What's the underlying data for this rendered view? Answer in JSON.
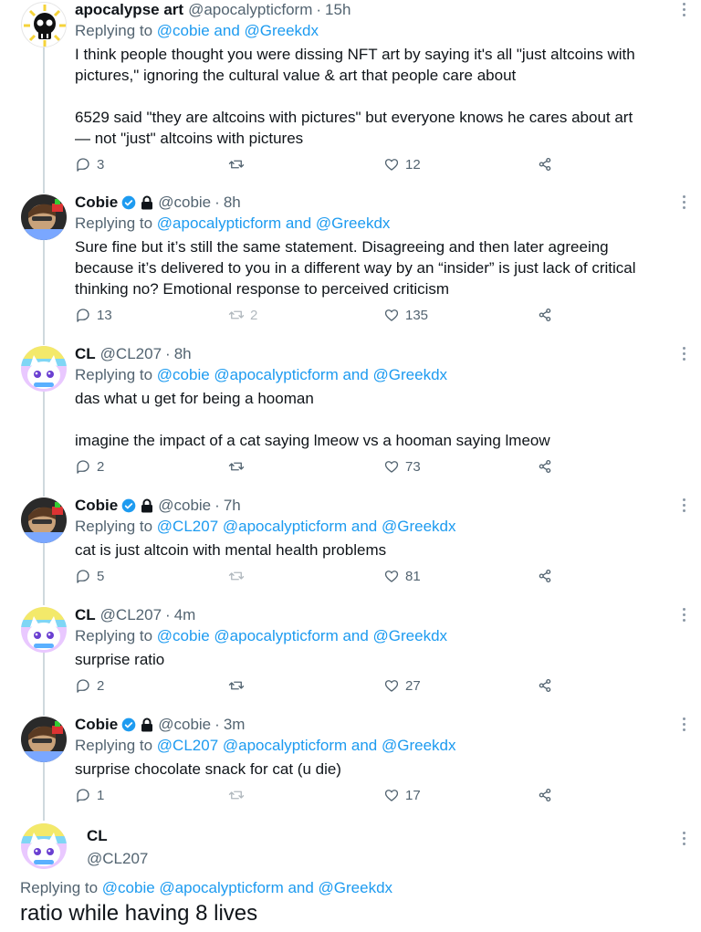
{
  "tweets": [
    {
      "name": "apocalypse art",
      "handle": "@apocalypticform",
      "time": "15h",
      "verified": false,
      "locked": false,
      "replying_label": "Replying to",
      "replying_links": "@cobie and @Greekdx",
      "text": "I think people thought you were dissing NFT art by saying it's all \"just altcoins with\npictures,\" ignoring the cultural value & art that people care about\n\n6529 said \"they are altcoins with pictures\" but everyone knows he cares about art\n— not \"just\" altcoins with pictures",
      "replies": "3",
      "retweets": "",
      "likes": "12"
    },
    {
      "name": "Cobie",
      "handle": "@cobie",
      "time": "8h",
      "verified": true,
      "locked": true,
      "replying_label": "Replying to",
      "replying_links": "@apocalypticform and @Greekdx",
      "text": "Sure fine but it’s still the same statement. Disagreeing and then later agreeing\nbecause it’s delivered to you in a different way by an “insider” is just lack of critical\nthinking no? Emotional response to perceived criticism",
      "replies": "13",
      "retweets": "2",
      "likes": "135"
    },
    {
      "name": "CL",
      "handle": "@CL207",
      "time": "8h",
      "verified": false,
      "locked": false,
      "replying_label": "Replying to",
      "replying_links": "@cobie @apocalypticform and @Greekdx",
      "text": "das what u get for being a hooman\n\nimagine the impact of a cat saying lmeow vs a hooman saying lmeow",
      "replies": "2",
      "retweets": "",
      "likes": "73"
    },
    {
      "name": "Cobie",
      "handle": "@cobie",
      "time": "7h",
      "verified": true,
      "locked": true,
      "replying_label": "Replying to",
      "replying_links": "@CL207 @apocalypticform and @Greekdx",
      "text": "cat is just altcoin with mental health problems",
      "replies": "5",
      "retweets": "",
      "likes": "81"
    },
    {
      "name": "CL",
      "handle": "@CL207",
      "time": "4m",
      "verified": false,
      "locked": false,
      "replying_label": "Replying to",
      "replying_links": "@cobie @apocalypticform and @Greekdx",
      "text": "surprise ratio",
      "replies": "2",
      "retweets": "",
      "likes": "27"
    },
    {
      "name": "Cobie",
      "handle": "@cobie",
      "time": "3m",
      "verified": true,
      "locked": true,
      "replying_label": "Replying to",
      "replying_links": "@CL207 @apocalypticform and @Greekdx",
      "text": "surprise chocolate snack for cat (u die)",
      "replies": "1",
      "retweets": "",
      "likes": "17"
    }
  ],
  "focused": {
    "name": "CL",
    "handle": "@CL207",
    "replying_label": "Replying to",
    "replying_links": "@cobie @apocalypticform and @Greekdx",
    "text": "ratio while having 8 lives"
  },
  "icons": {
    "reply": "reply-icon",
    "retweet": "retweet-icon",
    "like": "heart-icon",
    "share": "share-icon",
    "more": "more-icon",
    "verified": "verified-badge-icon",
    "locked": "lock-icon"
  },
  "colors": {
    "link": "#1d9bf0",
    "muted_text": "#536471",
    "thread_line": "#cfd9de",
    "verified": "#1d9bf0"
  }
}
